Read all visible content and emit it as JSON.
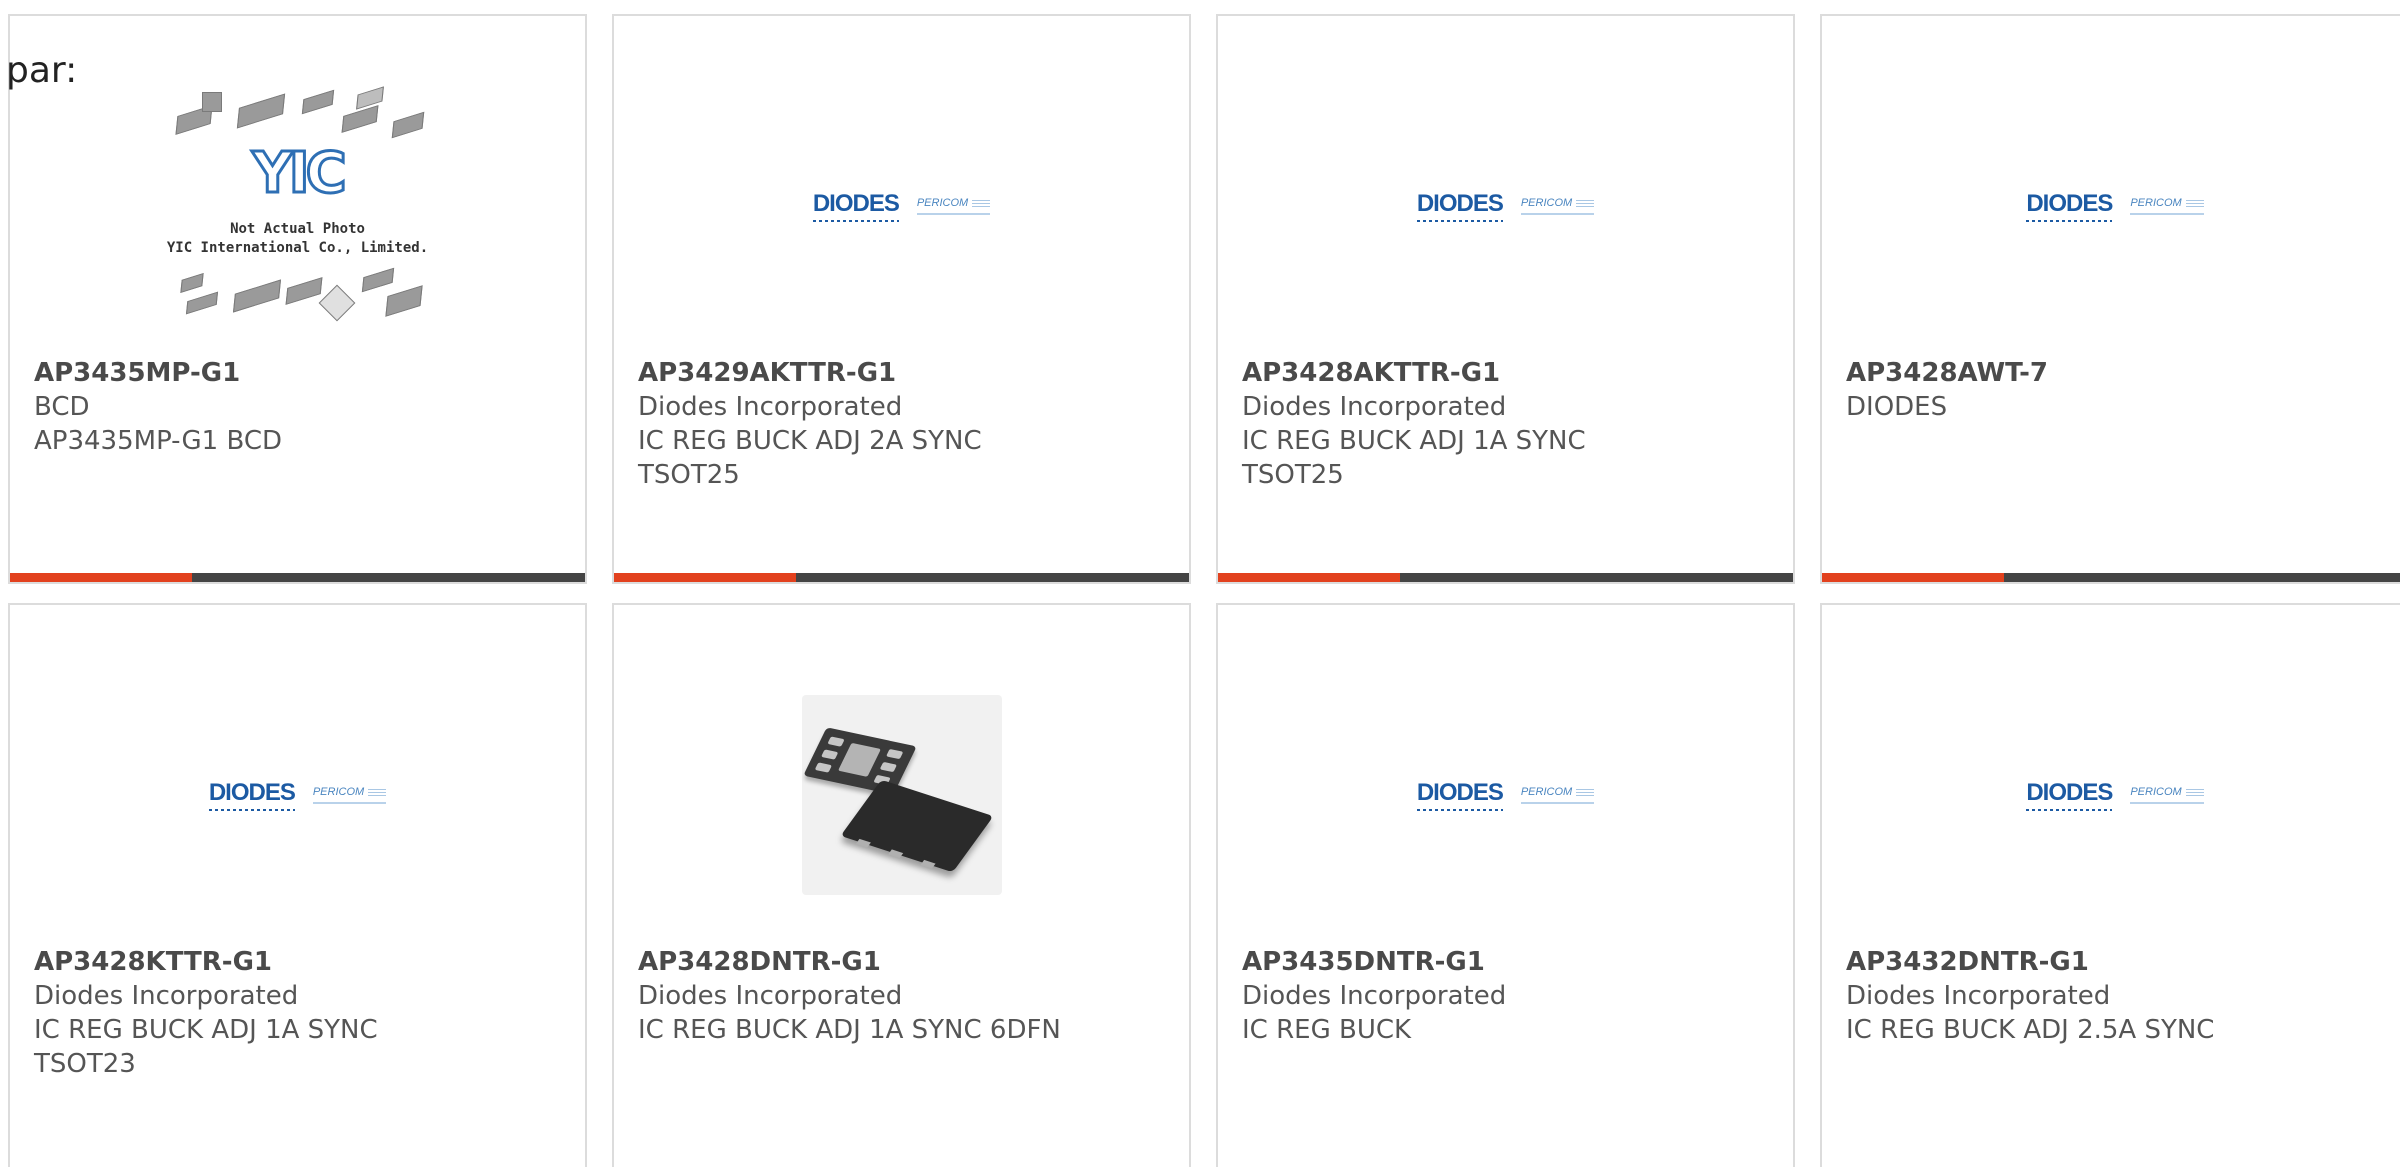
{
  "prefix_text": "par:",
  "accent_color": "#e2411e",
  "bar_color": "#444444",
  "products": [
    {
      "part_number": "AP3435MP-G1",
      "manufacturer": "BCD",
      "description": "AP3435MP-G1 BCD",
      "image": "yic-placeholder",
      "image_note": "Not Actual Photo\nYIC International Co., Limited.",
      "image_logo": "YIC"
    },
    {
      "part_number": "AP3429AKTTR-G1",
      "manufacturer": "Diodes Incorporated",
      "description": "IC REG BUCK ADJ 2A SYNC\nTSOT25",
      "image": "diodes-logo",
      "logo_main": "DIODES",
      "logo_sub": "PERICOM"
    },
    {
      "part_number": "AP3428AKTTR-G1",
      "manufacturer": "Diodes Incorporated",
      "description": "IC REG BUCK ADJ 1A SYNC\nTSOT25",
      "image": "diodes-logo",
      "logo_main": "DIODES",
      "logo_sub": "PERICOM"
    },
    {
      "part_number": "AP3428AWT-7",
      "manufacturer": "DIODES",
      "description": "",
      "image": "diodes-logo",
      "logo_main": "DIODES",
      "logo_sub": "PERICOM"
    },
    {
      "part_number": "AP3428KTTR-G1",
      "manufacturer": "Diodes Incorporated",
      "description": "IC REG BUCK ADJ 1A SYNC\nTSOT23",
      "image": "diodes-logo",
      "logo_main": "DIODES",
      "logo_sub": "PERICOM"
    },
    {
      "part_number": "AP3428DNTR-G1",
      "manufacturer": "Diodes Incorporated",
      "description": "IC REG BUCK ADJ 1A SYNC 6DFN",
      "image": "dfn-chip-photo"
    },
    {
      "part_number": "AP3435DNTR-G1",
      "manufacturer": "Diodes Incorporated",
      "description": "IC REG BUCK",
      "image": "diodes-logo",
      "logo_main": "DIODES",
      "logo_sub": "PERICOM"
    },
    {
      "part_number": "AP3432DNTR-G1",
      "manufacturer": "Diodes Incorporated",
      "description": "IC REG BUCK ADJ 2.5A SYNC",
      "image": "diodes-logo",
      "logo_main": "DIODES",
      "logo_sub": "PERICOM"
    }
  ]
}
